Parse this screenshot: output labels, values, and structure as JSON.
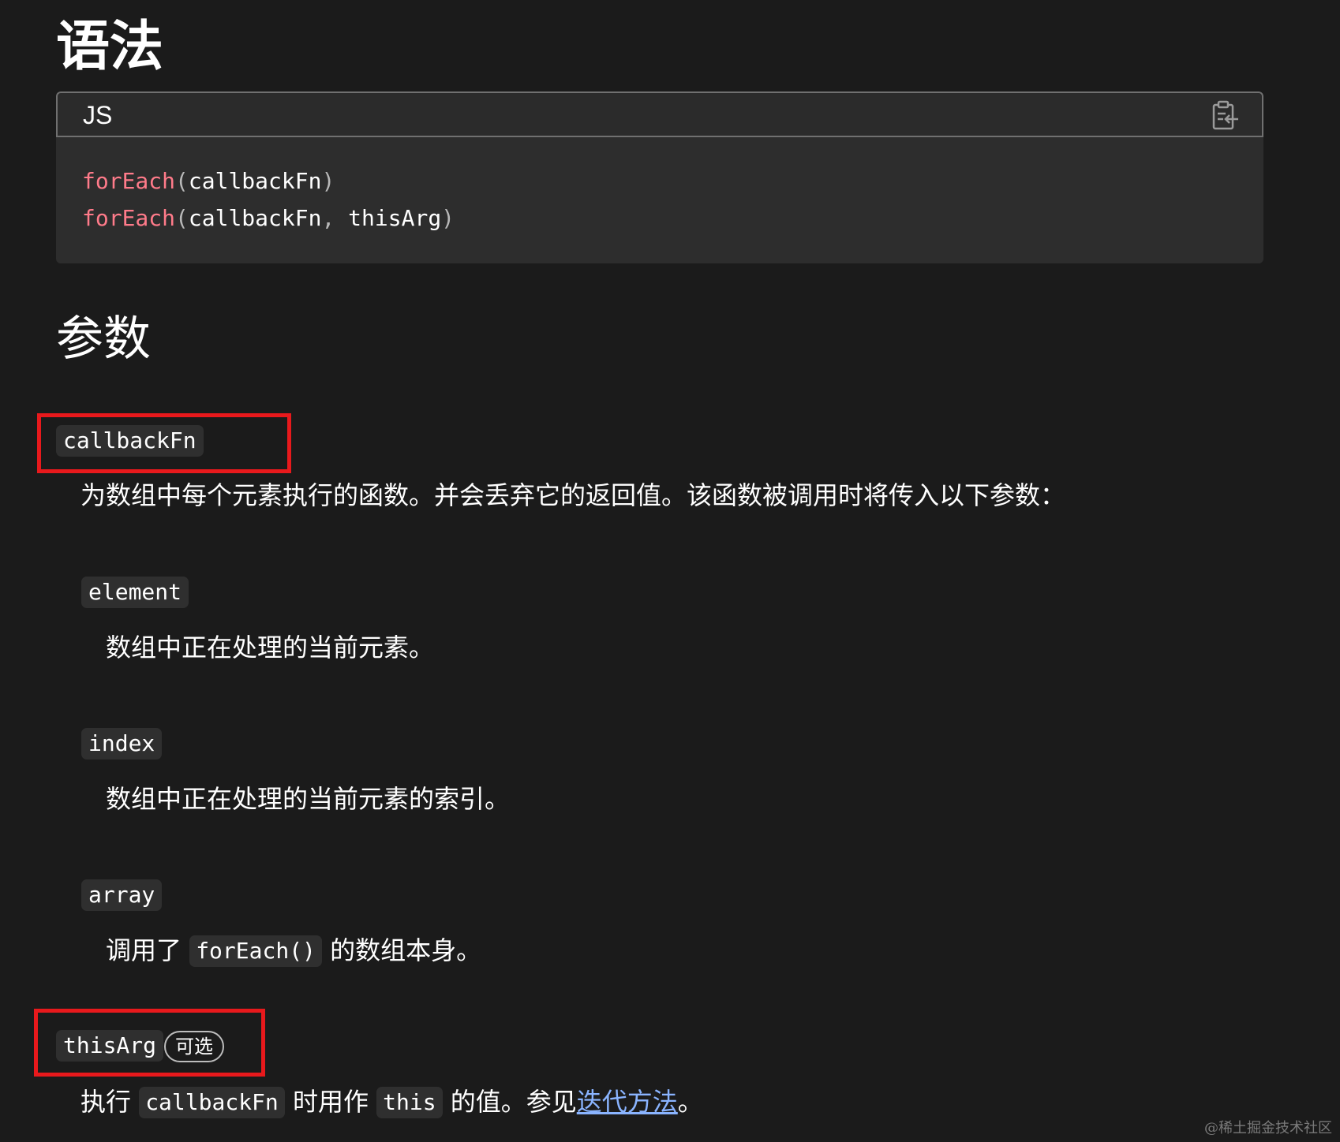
{
  "syntax": {
    "heading": "语法",
    "language": "JS",
    "copy_icon": "clipboard-icon",
    "lines": [
      {
        "fn": "forEach",
        "open": "(",
        "args": "callbackFn",
        "sep": "",
        "args2": "",
        "close": ")"
      },
      {
        "fn": "forEach",
        "open": "(",
        "args": "callbackFn",
        "sep": ",",
        "args2": " thisArg",
        "close": ")"
      }
    ]
  },
  "params": {
    "heading": "参数",
    "callbackFn": {
      "name": "callbackFn",
      "description": "为数组中每个元素执行的函数。并会丢弃它的返回值。该函数被调用时将传入以下参数："
    },
    "element": {
      "name": "element",
      "description": "数组中正在处理的当前元素。"
    },
    "index": {
      "name": "index",
      "description": "数组中正在处理的当前元素的索引。"
    },
    "array": {
      "name": "array",
      "desc_prefix": "调用了",
      "desc_code": "forEach()",
      "desc_suffix": "的数组本身。"
    },
    "thisArg": {
      "name": "thisArg",
      "badge": "可选",
      "desc_prefix": "执行",
      "desc_code1": "callbackFn",
      "desc_mid1": "时用作",
      "desc_code2": "this",
      "desc_mid2": "的值。参见",
      "link_text": "迭代方法",
      "desc_suffix": "。"
    }
  },
  "highlight_color": "#e8191c",
  "watermark": "@稀土掘金技术社区"
}
